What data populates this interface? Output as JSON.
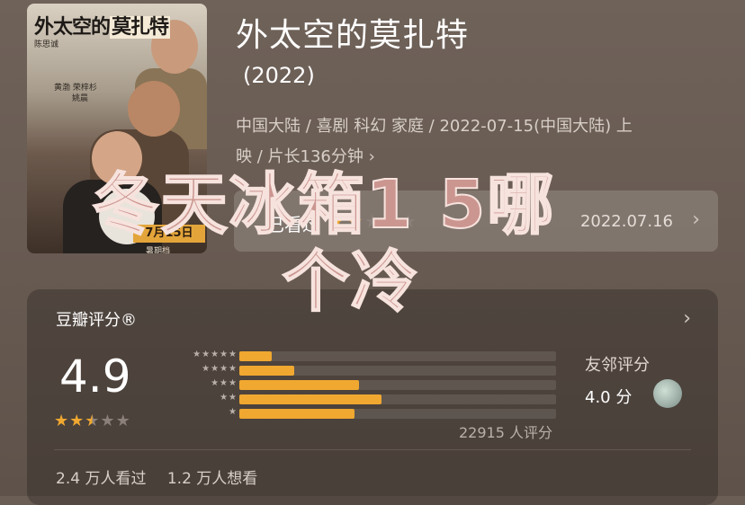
{
  "movie": {
    "title": "外太空的莫扎特",
    "year": "(2022)",
    "meta_line1": "中国大陆 / 喜剧 科幻 家庭 / 2022-07-15(中国大陆) 上",
    "meta_line2": "映 / 片长136分钟",
    "chevron": "›"
  },
  "poster": {
    "title_a": "外太空的",
    "title_b": "莫扎特",
    "credit_1": "陈思诚",
    "credit_2": "黄渤 荣梓杉",
    "credit_3": "姚晨",
    "date": "7月15日",
    "date_sub": "暑期档"
  },
  "watched": {
    "label": "已看过",
    "user_stars": 2,
    "date": "2022.07.16",
    "chevron": "›"
  },
  "overlay": {
    "line1": "冬天冰箱1 5哪",
    "line2": "个冷"
  },
  "rating": {
    "title": "豆瓣评分®",
    "chevron": "›",
    "score": "4.9",
    "stars_value": 2.5,
    "distribution": [
      {
        "label": "★★★★★",
        "pct": 0.07
      },
      {
        "label": "★★★★",
        "pct": 0.12
      },
      {
        "label": "★★★",
        "pct": 0.26
      },
      {
        "label": "★★",
        "pct": 0.31
      },
      {
        "label": "★",
        "pct": 0.25
      }
    ],
    "count_text": "22915 人评分",
    "friend_label": "友邻评分",
    "friend_score": "4.0 分"
  },
  "social": {
    "watched": "2.4 万人看过",
    "wish": "1.2 万人想看"
  },
  "colors": {
    "accent": "#f0a830",
    "overlay_text": "#cc9690"
  }
}
